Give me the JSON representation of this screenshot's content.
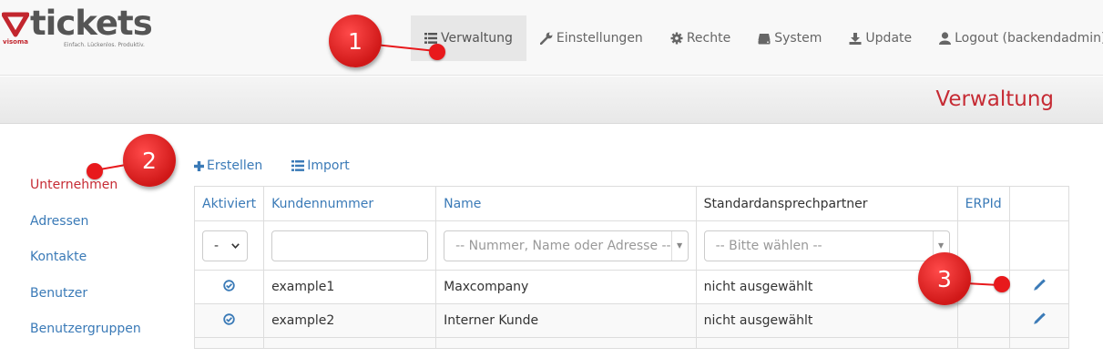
{
  "brand": {
    "name": "tickets",
    "maker": "visoma",
    "tagline": "Einfach. Lückenlos. Produktiv."
  },
  "nav": [
    {
      "label": "Verwaltung",
      "icon": "list-icon",
      "active": true
    },
    {
      "label": "Einstellungen",
      "icon": "wrench-icon"
    },
    {
      "label": "Rechte",
      "icon": "gear-icon"
    },
    {
      "label": "System",
      "icon": "hdd-icon"
    },
    {
      "label": "Update",
      "icon": "download-icon"
    },
    {
      "label": "Logout (backendadmin)",
      "icon": "user-icon"
    }
  ],
  "page_title": "Verwaltung",
  "sidebar": [
    {
      "label": "Unternehmen",
      "active": true
    },
    {
      "label": "Adressen"
    },
    {
      "label": "Kontakte"
    },
    {
      "label": "Benutzer"
    },
    {
      "label": "Benutzergruppen"
    }
  ],
  "actions": {
    "create": "Erstellen",
    "import": "Import"
  },
  "table": {
    "headers": [
      "Aktiviert",
      "Kundennummer",
      "Name",
      "Standardansprechpartner",
      "ERPId"
    ],
    "filters": {
      "active_value": "-",
      "name_placeholder": "-- Nummer, Name oder Adresse --",
      "contact_placeholder": "-- Bitte wählen --"
    },
    "rows": [
      {
        "number": "example1",
        "name": "Maxcompany",
        "contact": "nicht ausgewählt",
        "erp": ""
      },
      {
        "number": "example2",
        "name": "Interner Kunde",
        "contact": "nicht ausgewählt",
        "erp": ""
      }
    ]
  },
  "callouts": [
    "1",
    "2",
    "3"
  ],
  "colors": {
    "accent": "#c62b34",
    "link": "#3a7ab7",
    "callout": "#e8191c"
  }
}
